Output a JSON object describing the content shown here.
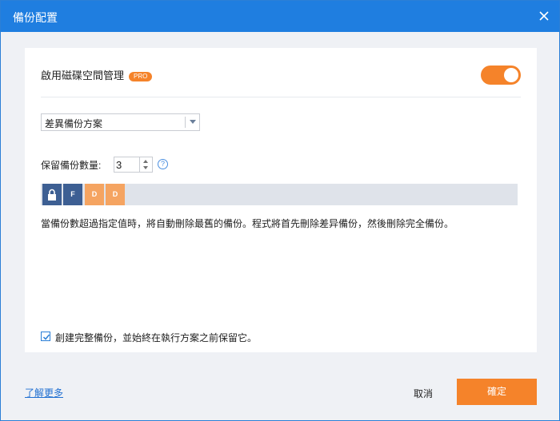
{
  "window": {
    "title": "備份配置"
  },
  "disk_management": {
    "label": "啟用磁碟空間管理",
    "badge": "PRO",
    "enabled": true
  },
  "scheme": {
    "selected": "差異備份方案"
  },
  "retention": {
    "label": "保留備份數量:",
    "value": "3",
    "help_glyph": "?"
  },
  "backup_blocks": [
    {
      "type": "lock-icon",
      "text": ""
    },
    {
      "type": "full",
      "text": "F"
    },
    {
      "type": "differential",
      "text": "D"
    },
    {
      "type": "differential",
      "text": "D"
    }
  ],
  "note": "當備份數超過指定值時，將自動刪除最舊的備份。程式將首先刪除差异備份，然後刪除完全備份。",
  "create_full": {
    "checked": true,
    "label": "創建完整備份，並始終在執行方案之前保留它。"
  },
  "footer": {
    "learn_more": "了解更多",
    "cancel": "取消",
    "confirm": "確定"
  },
  "colors": {
    "accent": "#1f7ee0",
    "orange": "#f5832a",
    "full_block": "#3d5f93",
    "diff_block": "#f5a461"
  }
}
